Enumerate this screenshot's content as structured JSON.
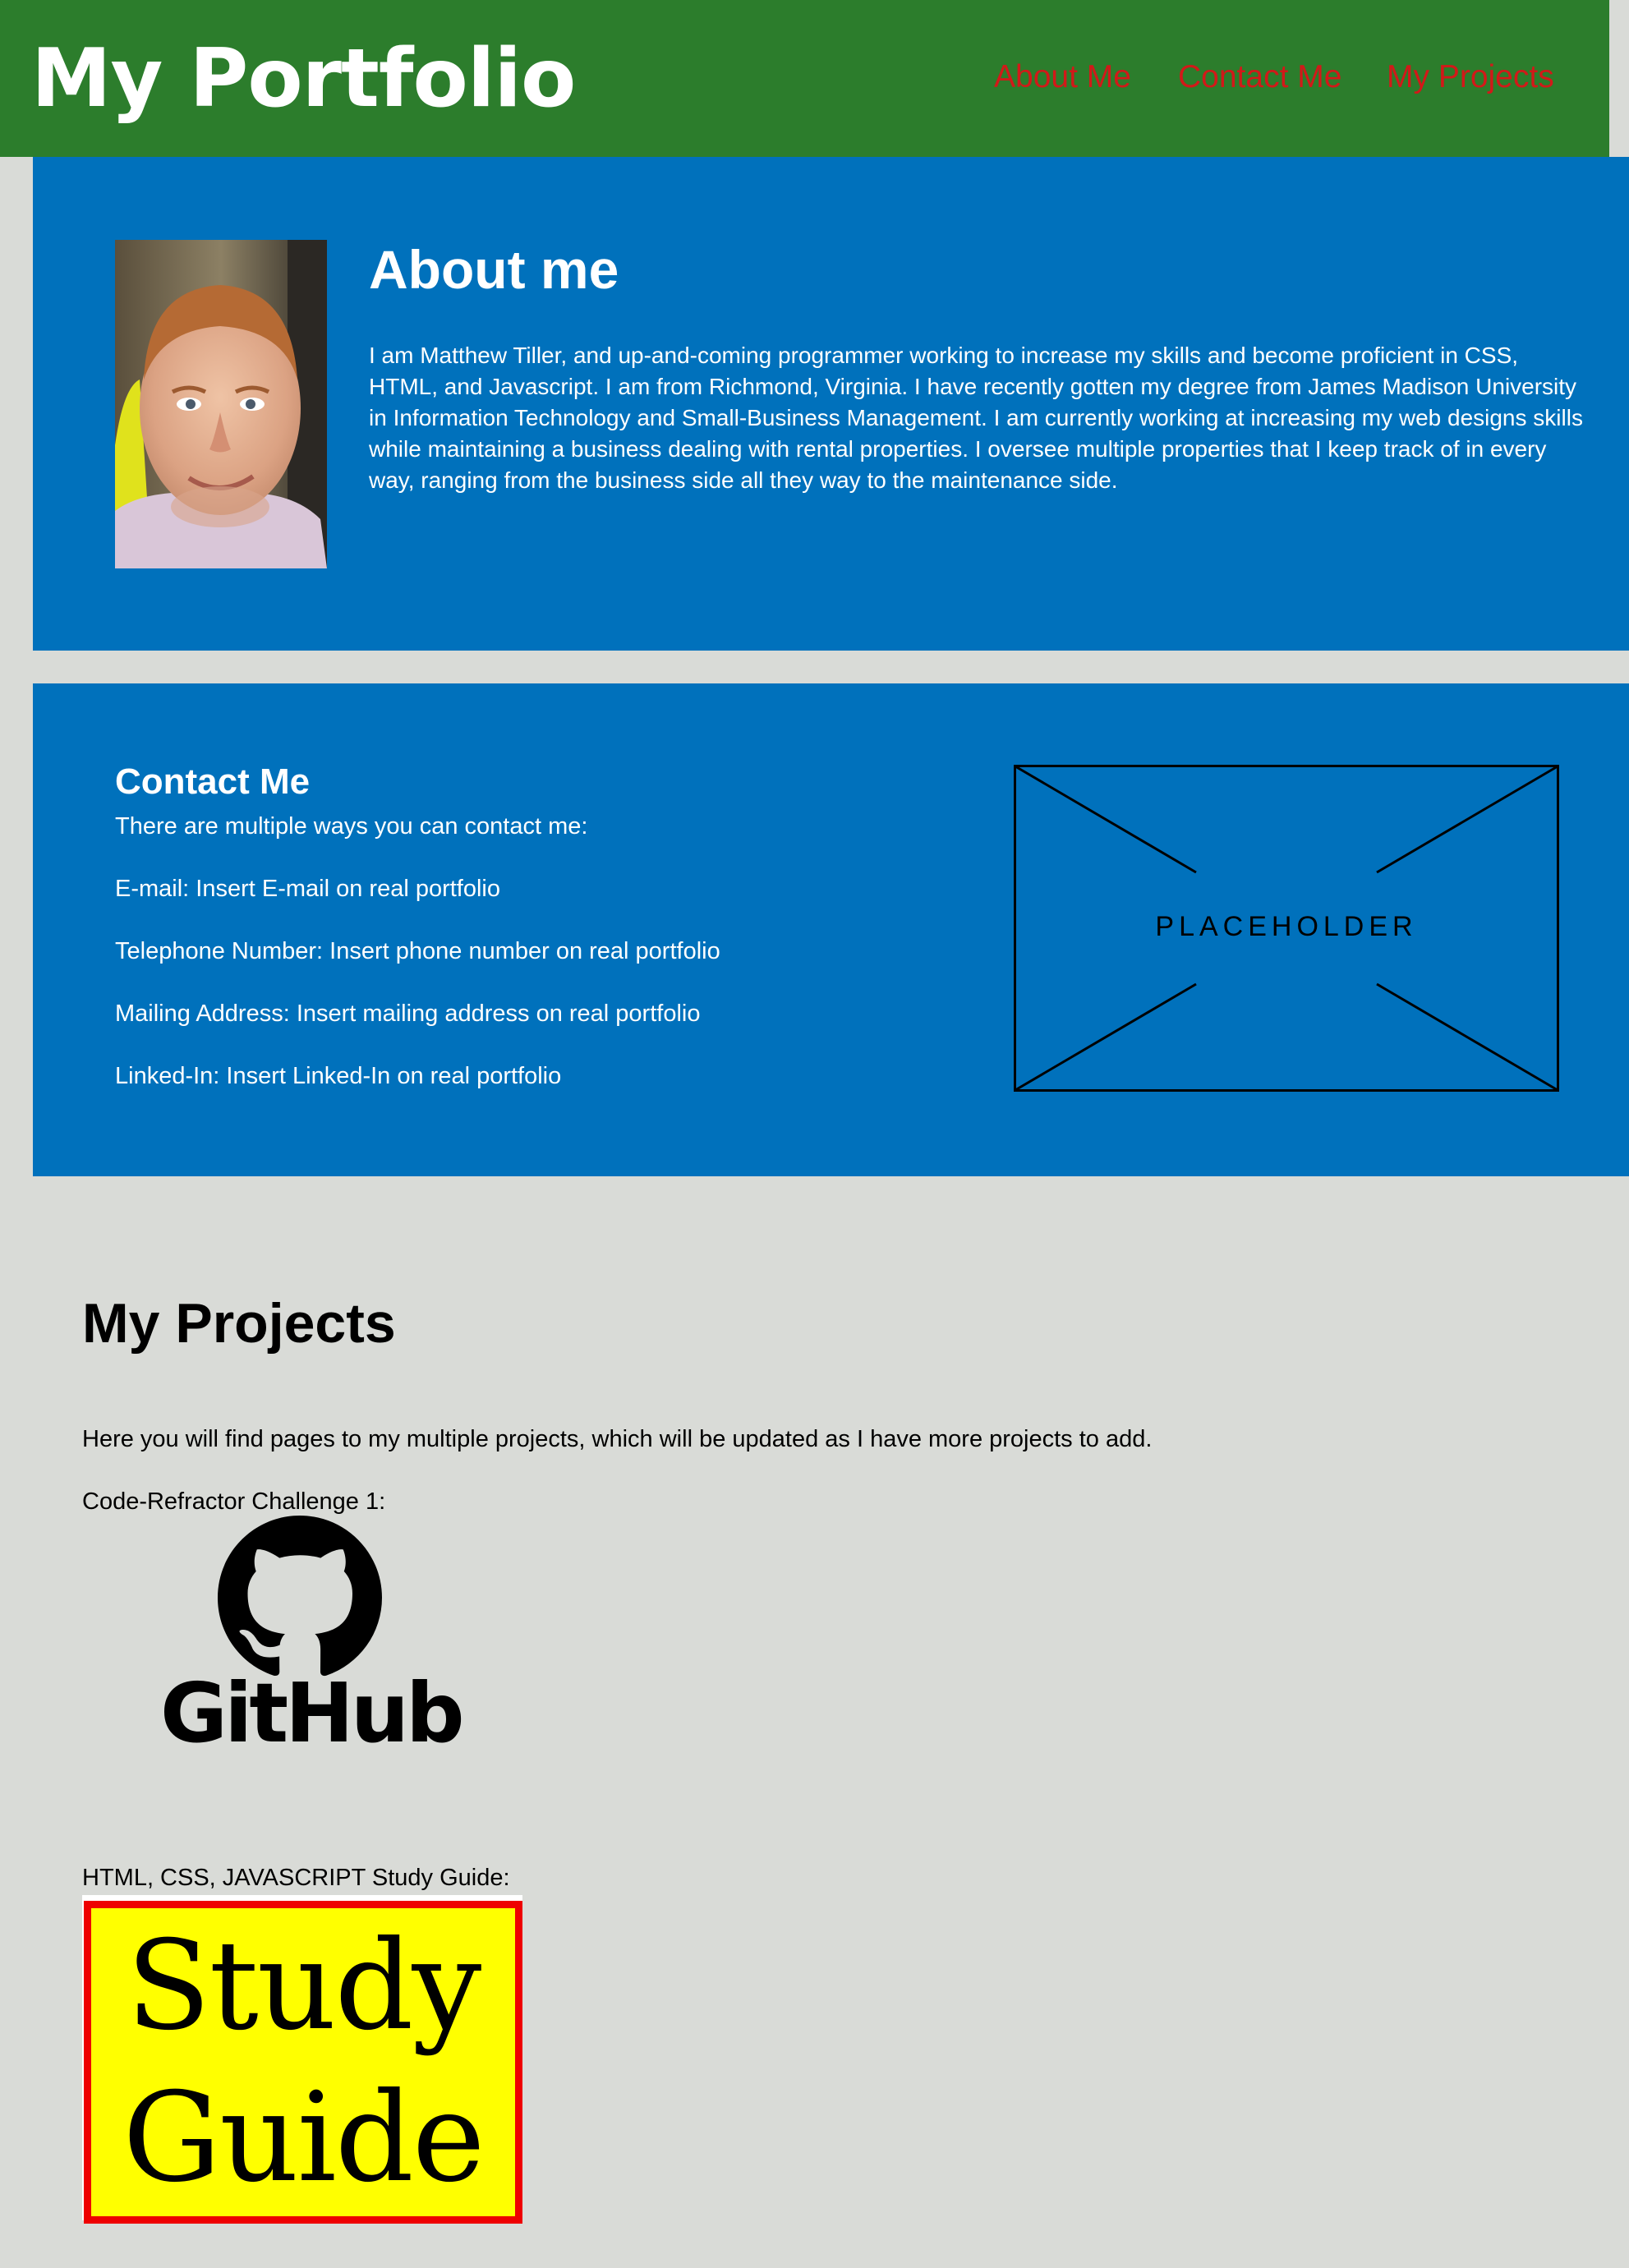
{
  "header": {
    "title": "My Portfolio",
    "nav": [
      {
        "label": "About Me"
      },
      {
        "label": "Contact Me"
      },
      {
        "label": "My Projects"
      }
    ]
  },
  "about": {
    "heading": "About me",
    "photo_icon": "profile-photo",
    "text": "I am Matthew Tiller, and up-and-coming programmer working to increase my skills and become proficient in CSS, HTML, and Javascript. I am from Richmond, Virginia. I have recently gotten my degree from James Madison University in Information Technology and Small-Business Management. I am currently working at increasing my web designs skills while maintaining a business dealing with rental properties. I oversee multiple properties that I keep track of in every way, ranging from the business side all they way to the maintenance side."
  },
  "contact": {
    "heading": "Contact Me",
    "intro": "There are multiple ways you can contact me:",
    "email": "E-mail: Insert E-mail on real portfolio",
    "phone": "Telephone Number: Insert phone number on real portfolio",
    "mailing": "Mailing Address: Insert mailing address on real portfolio",
    "linkedin": "Linked-In: Insert Linked-In on real portfolio",
    "placeholder_label": "PLACEHOLDER"
  },
  "projects": {
    "heading": "My Projects",
    "intro": "Here you will find pages to my multiple projects, which will be updated as I have more projects to add.",
    "items": [
      {
        "label": "Code-Refractor Challenge 1:",
        "logo_text": "GitHub",
        "icon": "github-icon"
      },
      {
        "label": "HTML, CSS, JAVASCRIPT Study Guide:",
        "image_text_line1": "Study",
        "image_text_line2": "Guide"
      }
    ]
  },
  "colors": {
    "header_bg": "#2c7d2c",
    "section_blue": "#0071bc",
    "page_bg": "#d9dbd7",
    "nav_link": "#d21919",
    "study_yellow": "#ffff00",
    "study_border": "#ee0000"
  }
}
